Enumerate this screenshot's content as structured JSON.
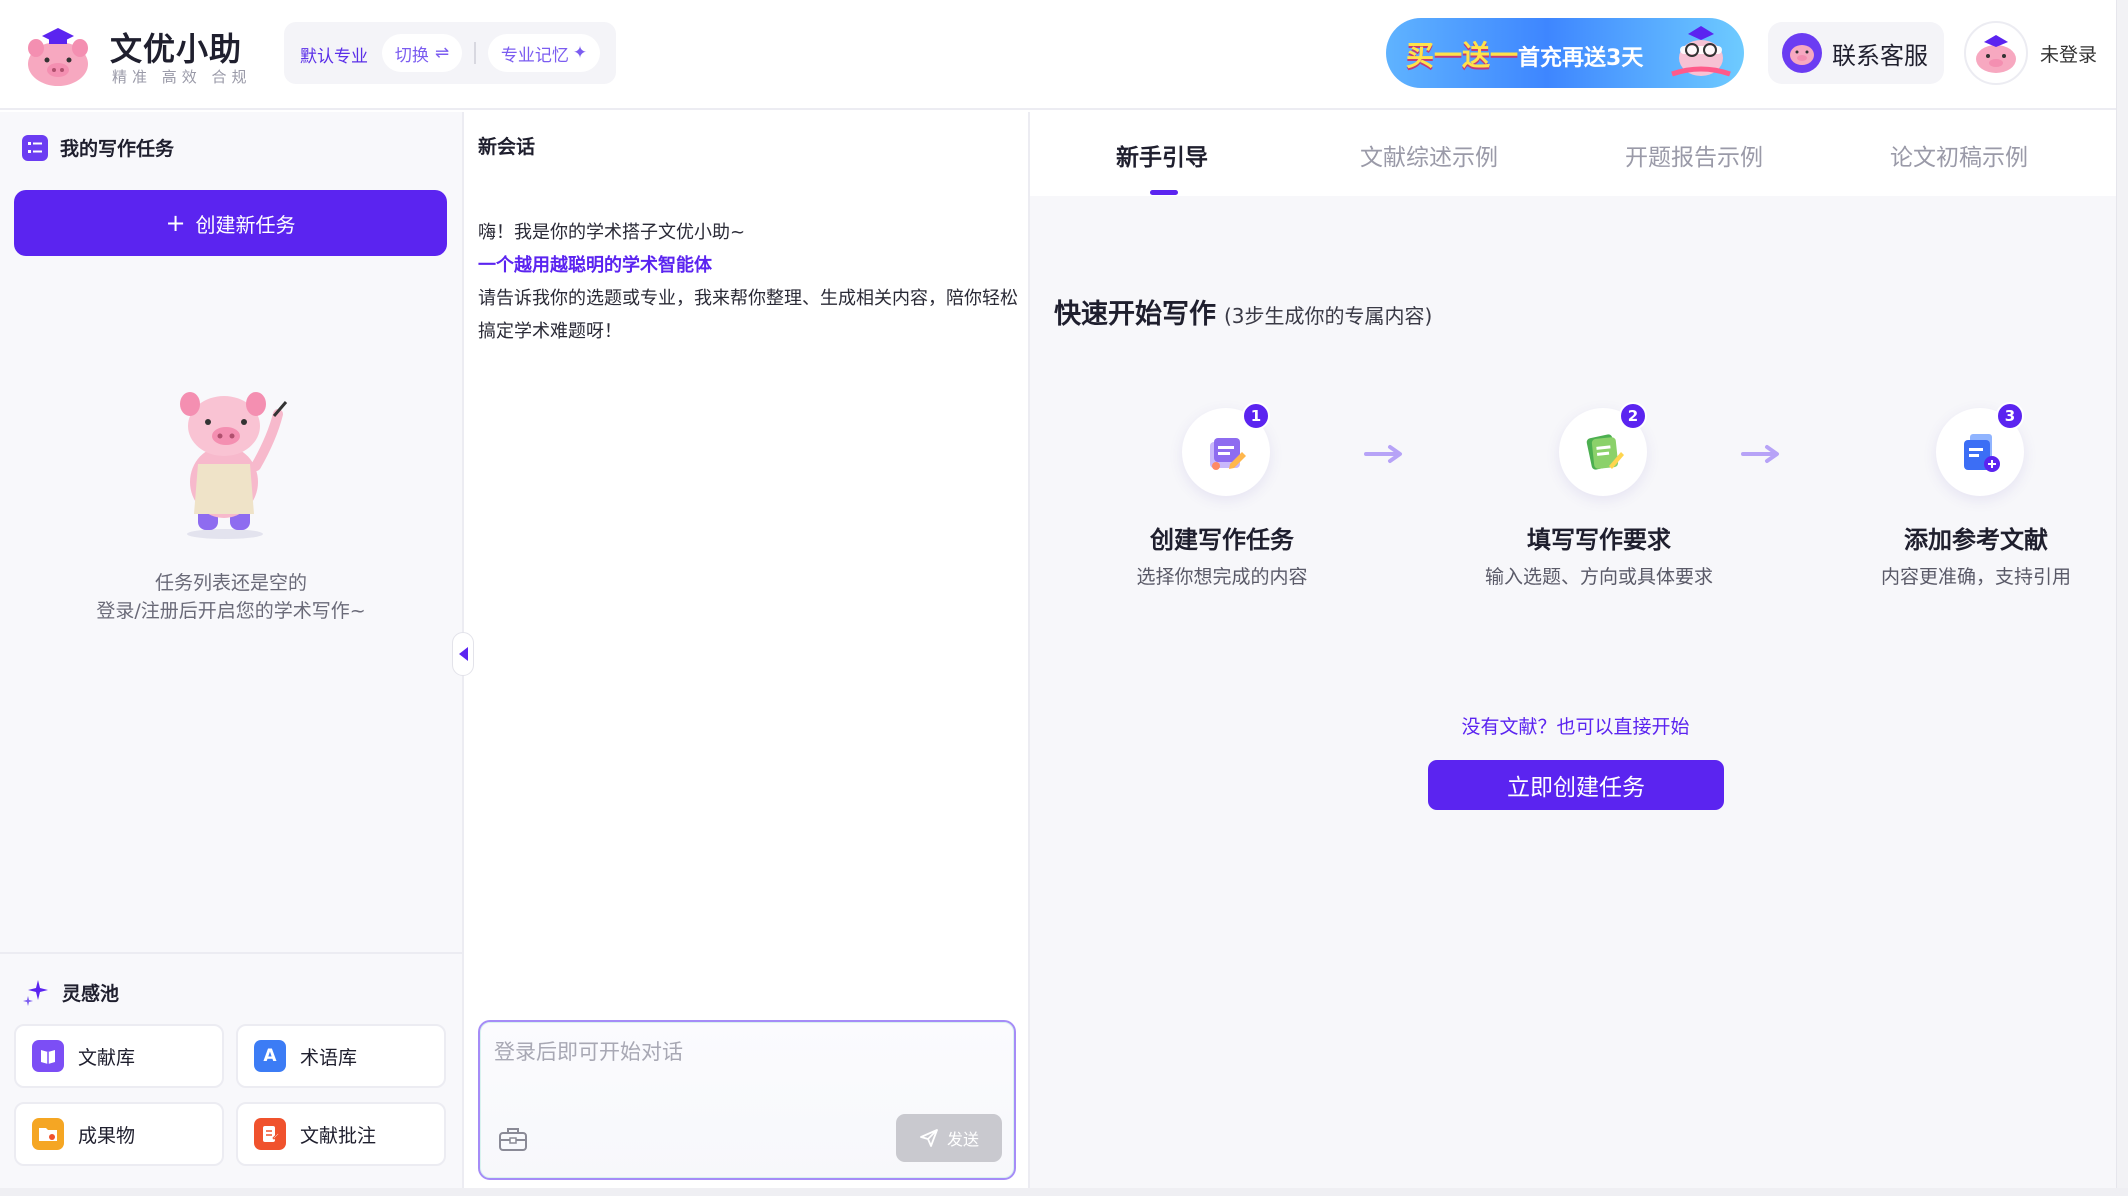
{
  "header": {
    "brand_name": "文优小助",
    "brand_slogan": "精准 高效 合规",
    "major_default": "默认专业",
    "major_switch": "切换",
    "major_memory": "专业记忆",
    "promo_main": "买一送一",
    "promo_sub": "首充再送3天",
    "service_label": "联系客服",
    "login_label": "未登录"
  },
  "sidebar": {
    "tasks_title": "我的写作任务",
    "create_label": "创建新任务",
    "empty_line1": "任务列表还是空的",
    "empty_line2": "登录/注册后开启您的学术写作~",
    "inspire_title": "灵感池",
    "tools": [
      {
        "label": "文献库",
        "icon": "book-icon",
        "color": "#7c4ef5"
      },
      {
        "label": "术语库",
        "icon": "letter-a-icon",
        "color": "#3c7cf5"
      },
      {
        "label": "成果物",
        "icon": "folder-icon",
        "color": "#f5a623"
      },
      {
        "label": "文献批注",
        "icon": "annotate-icon",
        "color": "#f0522d"
      }
    ]
  },
  "chat": {
    "title": "新会话",
    "greeting": "嗨！我是你的学术搭子文优小助~",
    "highlight": "一个越用越聪明的学术智能体",
    "intro": "请告诉我你的选题或专业，我来帮你整理、生成相关内容，陪你轻松搞定学术难题呀！",
    "input_placeholder": "登录后即可开始对话",
    "send_label": "发送"
  },
  "guide": {
    "tabs": [
      "新手引导",
      "文献综述示例",
      "开题报告示例",
      "论文初稿示例"
    ],
    "active_tab": 0,
    "heading": "快速开始写作",
    "heading_sub": "(3步生成你的专属内容)",
    "steps": [
      {
        "num": "1",
        "title": "创建写作任务",
        "desc": "选择你想完成的内容",
        "icon": "task-create-icon"
      },
      {
        "num": "2",
        "title": "填写写作要求",
        "desc": "输入选题、方向或具体要求",
        "icon": "notes-edit-icon"
      },
      {
        "num": "3",
        "title": "添加参考文献",
        "desc": "内容更准确，支持引用",
        "icon": "reference-add-icon"
      }
    ],
    "no_ref_hint": "没有文献？也可以直接开始",
    "start_button": "立即创建任务"
  },
  "colors": {
    "accent": "#5b24f0",
    "accent_light": "#7b5cf0",
    "send_disabled": "#c9c9cf"
  }
}
